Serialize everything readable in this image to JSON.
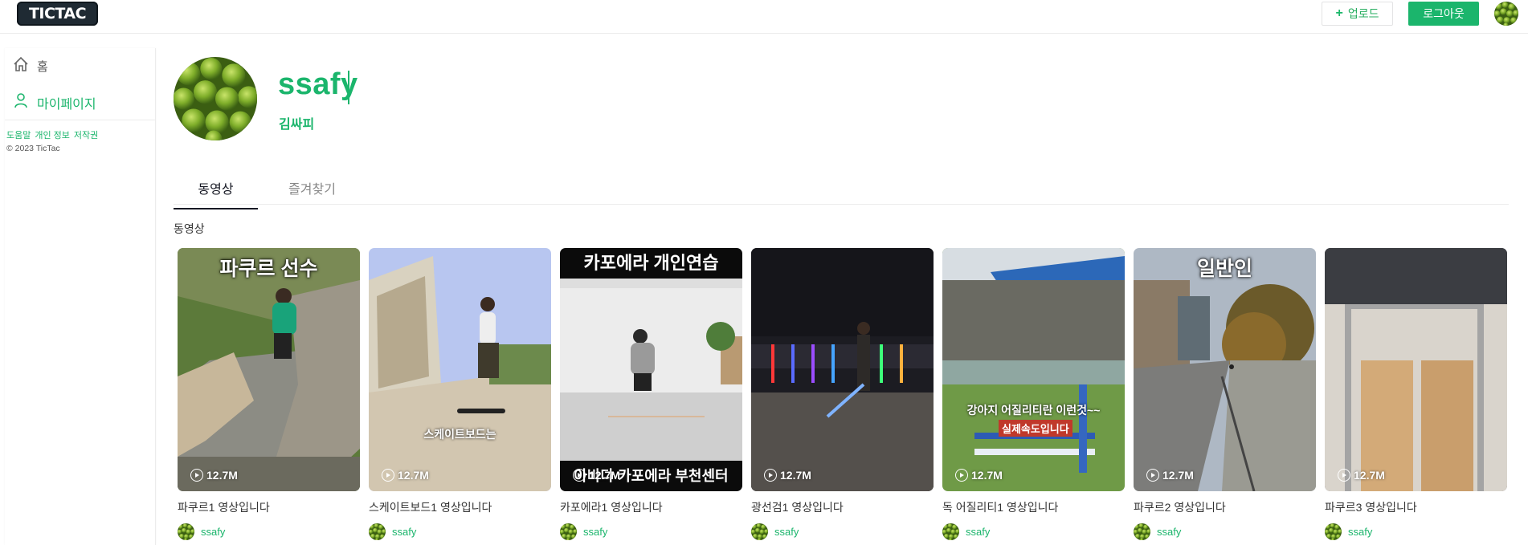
{
  "header": {
    "logo": "TICTAC",
    "upload_label": "업로드",
    "upload_icon": "plus-icon",
    "logout_label": "로그아웃"
  },
  "sidebar": {
    "items": [
      {
        "label": "홈",
        "icon": "home-icon"
      },
      {
        "label": "마이페이지",
        "icon": "user-icon"
      }
    ],
    "footer_links": [
      "도움말",
      "개인 정보",
      "저작권"
    ],
    "copyright": "© 2023 TicTac"
  },
  "profile": {
    "username": "ssafy",
    "name": "김싸피"
  },
  "tabs": [
    {
      "label": "동영상",
      "active": true
    },
    {
      "label": "즐겨찾기",
      "active": false
    }
  ],
  "section_label": "동영상",
  "videos": [
    {
      "title": "파쿠르1 영상입니다",
      "author": "ssafy",
      "views": "12.7M",
      "overlay_top": "파쿠르 선수"
    },
    {
      "title": "스케이트보드1 영상입니다",
      "author": "ssafy",
      "views": "12.7M",
      "overlay_mid": "스케이트보드는"
    },
    {
      "title": "카포에라1 영상입니다",
      "author": "ssafy",
      "views": "12.7M",
      "overlay_top": "카포에라 개인연습",
      "overlay_bottom": "아바다 카포에라 부천센터"
    },
    {
      "title": "광선검1 영상입니다",
      "author": "ssafy",
      "views": "12.7M"
    },
    {
      "title": "독 어질리티1 영상입니다",
      "author": "ssafy",
      "views": "12.7M",
      "overlay_mid": "강아지 어질리티란 이런것~~",
      "overlay_tag": "실제속도입니다"
    },
    {
      "title": "파쿠르2 영상입니다",
      "author": "ssafy",
      "views": "12.7M",
      "overlay_top": "일반인"
    },
    {
      "title": "파쿠르3 영상입니다",
      "author": "ssafy",
      "views": "12.7M"
    }
  ],
  "colors": {
    "accent": "#1bb56c",
    "logo_bg": "#1f2a33",
    "text": "#161823"
  }
}
